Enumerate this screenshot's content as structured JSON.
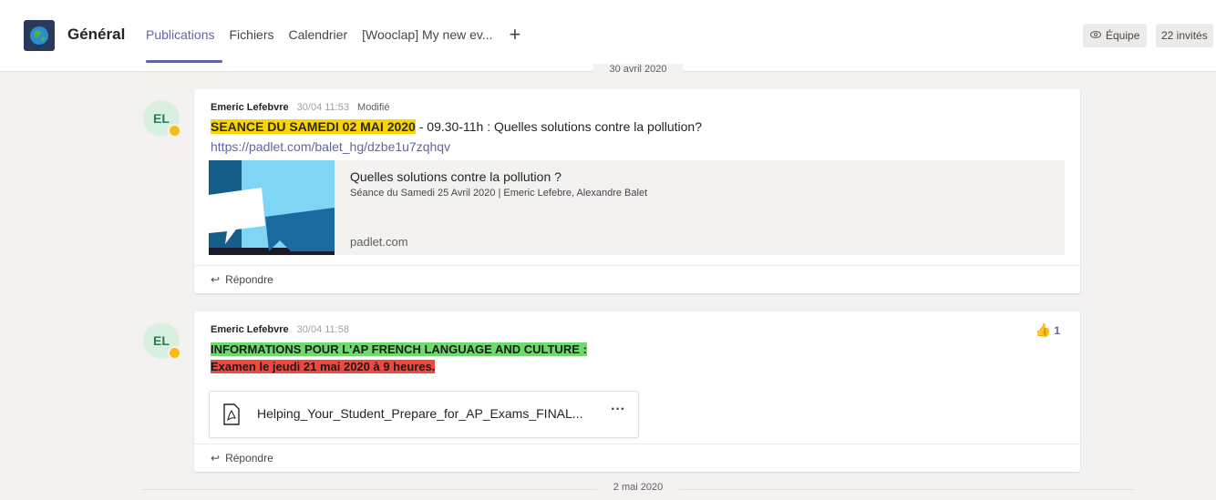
{
  "header": {
    "channel_name": "Général",
    "tabs": [
      {
        "label": "Publications",
        "active": true
      },
      {
        "label": "Fichiers"
      },
      {
        "label": "Calendrier"
      },
      {
        "label": "[Wooclap] My new ev..."
      }
    ],
    "add_tab_icon": "+",
    "team_button_label": "Équipe",
    "guests_label": "22 invités"
  },
  "dates": {
    "top": "30 avril 2020",
    "bottom": "2 mai 2020"
  },
  "messages": [
    {
      "avatar_initials": "EL",
      "author": "Emeric Lefebvre",
      "time": "30/04 11:53",
      "edited_label": "Modifié",
      "highlight_text": "SEANCE DU SAMEDI 02 MAI 2020",
      "rest_text": " - 09.30-11h : Quelles solutions contre la pollution?",
      "link": "https://padlet.com/balet_hg/dzbe1u7zqhqv",
      "preview": {
        "title": "Quelles solutions contre la pollution ?",
        "description": "Séance du Samedi 25 Avril 2020 | Emeric Lefebre, Alexandre Balet",
        "domain": "padlet.com"
      },
      "reply_label": "Répondre"
    },
    {
      "avatar_initials": "EL",
      "author": "Emeric Lefebvre",
      "time": "30/04 11:58",
      "line_green": "INFORMATIONS POUR L'AP FRENCH LANGUAGE AND CULTURE :",
      "line_red": "Examen le jeudi 21 mai 2020 à 9 heures.",
      "reaction_count": "1",
      "file_name": "Helping_Your_Student_Prepare_for_AP_Exams_FINAL...",
      "file_more": "···",
      "reply_label": "Répondre"
    }
  ],
  "colors": {
    "accent": "#6264a7",
    "highlight_yellow": "#fbd500",
    "highlight_green": "#6fd96e",
    "highlight_red": "#f0483e"
  }
}
